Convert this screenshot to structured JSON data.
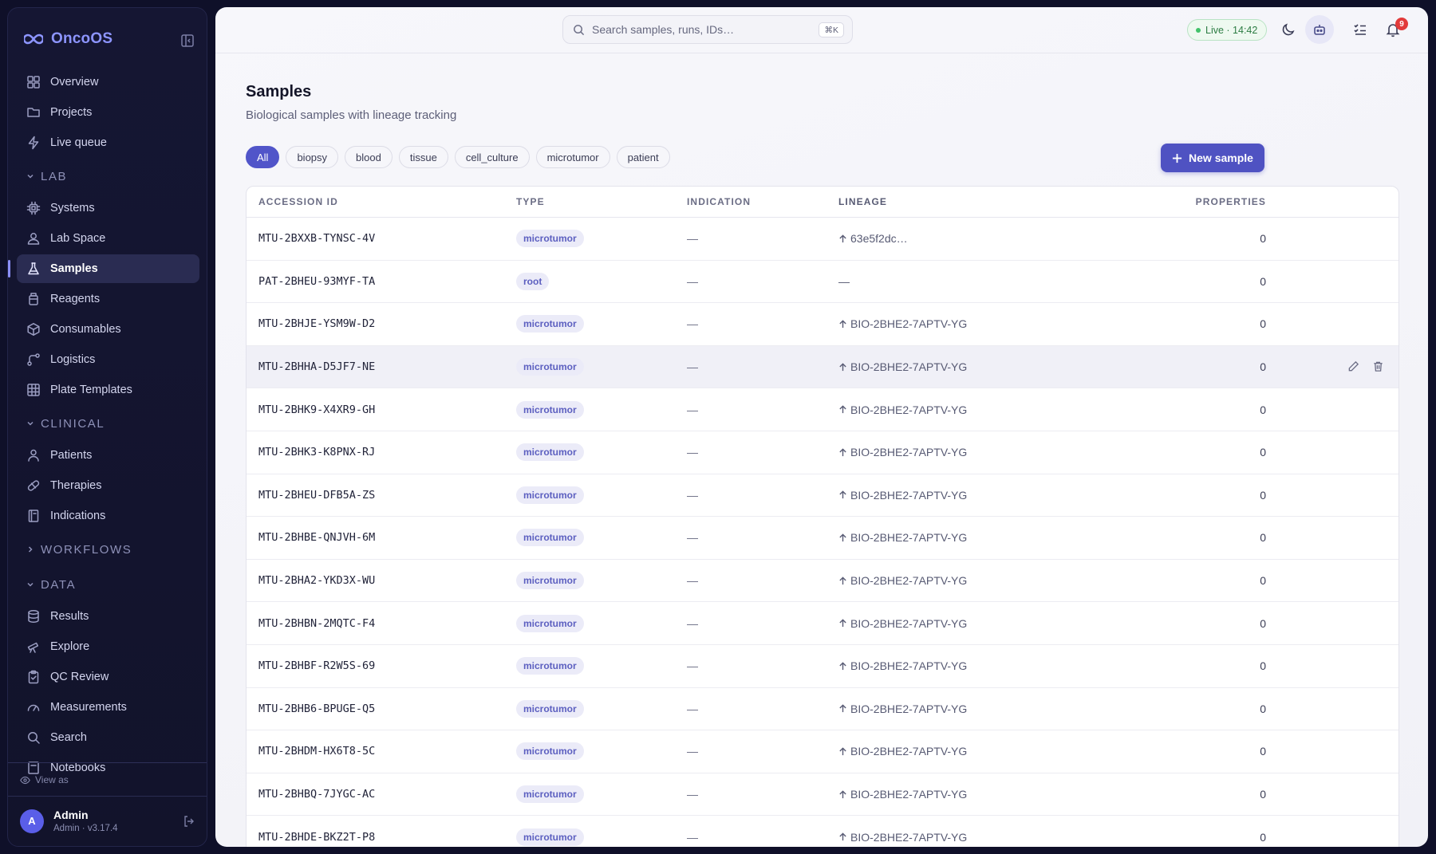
{
  "app": {
    "name": "OncoOS"
  },
  "sidebar": {
    "top_items": [
      {
        "label": "Overview",
        "icon": "grid-icon"
      },
      {
        "label": "Projects",
        "icon": "folder-icon"
      },
      {
        "label": "Live queue",
        "icon": "bolt-icon"
      }
    ],
    "sections": [
      {
        "label": "LAB",
        "expanded": true,
        "items": [
          {
            "label": "Systems",
            "icon": "cpu-icon"
          },
          {
            "label": "Lab Space",
            "icon": "user-space-icon"
          },
          {
            "label": "Samples",
            "icon": "flask-icon",
            "active": true
          },
          {
            "label": "Reagents",
            "icon": "bottle-icon"
          },
          {
            "label": "Consumables",
            "icon": "box-icon"
          },
          {
            "label": "Logistics",
            "icon": "route-icon"
          },
          {
            "label": "Plate Templates",
            "icon": "table-grid-icon"
          }
        ]
      },
      {
        "label": "CLINICAL",
        "expanded": true,
        "items": [
          {
            "label": "Patients",
            "icon": "person-icon"
          },
          {
            "label": "Therapies",
            "icon": "pill-icon"
          },
          {
            "label": "Indications",
            "icon": "book-icon"
          }
        ]
      },
      {
        "label": "WORKFLOWS",
        "expanded": false,
        "items": []
      },
      {
        "label": "DATA",
        "expanded": true,
        "items": [
          {
            "label": "Results",
            "icon": "database-icon"
          },
          {
            "label": "Explore",
            "icon": "telescope-icon"
          },
          {
            "label": "QC Review",
            "icon": "clipboard-icon"
          },
          {
            "label": "Measurements",
            "icon": "gauge-icon"
          },
          {
            "label": "Search",
            "icon": "search-icon"
          },
          {
            "label": "Notebooks",
            "icon": "notebook-icon"
          }
        ]
      }
    ],
    "view_as": "View as",
    "user": {
      "initial": "A",
      "name": "Admin",
      "subtitle": "Admin · v3.17.4"
    }
  },
  "topbar": {
    "search_placeholder": "Search samples, runs, IDs…",
    "search_shortcut": "⌘K",
    "live_label": "Live · 14:42",
    "notifications_count": "9"
  },
  "page": {
    "title": "Samples",
    "subtitle": "Biological samples with lineage tracking",
    "filters": [
      "All",
      "biopsy",
      "blood",
      "tissue",
      "cell_culture",
      "microtumor",
      "patient"
    ],
    "active_filter": "All",
    "new_button": "New sample"
  },
  "table": {
    "columns": {
      "accession": "ACCESSION ID",
      "type": "TYPE",
      "indication": "INDICATION",
      "lineage": "LINEAGE",
      "properties": "PROPERTIES"
    },
    "rows": [
      {
        "accession": "MTU-2BXXB-TYNSC-4V",
        "type": "microtumor",
        "indication": "—",
        "lineage": "63e5f2dc…",
        "lineage_arrow": true,
        "properties": "0"
      },
      {
        "accession": "PAT-2BHEU-93MYF-TA",
        "type": "root",
        "indication": "—",
        "lineage": "—",
        "lineage_arrow": false,
        "properties": "0"
      },
      {
        "accession": "MTU-2BHJE-YSM9W-D2",
        "type": "microtumor",
        "indication": "—",
        "lineage": "BIO-2BHE2-7APTV-YG",
        "lineage_arrow": true,
        "properties": "0"
      },
      {
        "accession": "MTU-2BHHA-D5JF7-NE",
        "type": "microtumor",
        "indication": "—",
        "lineage": "BIO-2BHE2-7APTV-YG",
        "lineage_arrow": true,
        "properties": "0",
        "hover": true
      },
      {
        "accession": "MTU-2BHK9-X4XR9-GH",
        "type": "microtumor",
        "indication": "—",
        "lineage": "BIO-2BHE2-7APTV-YG",
        "lineage_arrow": true,
        "properties": "0"
      },
      {
        "accession": "MTU-2BHK3-K8PNX-RJ",
        "type": "microtumor",
        "indication": "—",
        "lineage": "BIO-2BHE2-7APTV-YG",
        "lineage_arrow": true,
        "properties": "0"
      },
      {
        "accession": "MTU-2BHEU-DFB5A-ZS",
        "type": "microtumor",
        "indication": "—",
        "lineage": "BIO-2BHE2-7APTV-YG",
        "lineage_arrow": true,
        "properties": "0"
      },
      {
        "accession": "MTU-2BHBE-QNJVH-6M",
        "type": "microtumor",
        "indication": "—",
        "lineage": "BIO-2BHE2-7APTV-YG",
        "lineage_arrow": true,
        "properties": "0"
      },
      {
        "accession": "MTU-2BHA2-YKD3X-WU",
        "type": "microtumor",
        "indication": "—",
        "lineage": "BIO-2BHE2-7APTV-YG",
        "lineage_arrow": true,
        "properties": "0"
      },
      {
        "accession": "MTU-2BHBN-2MQTC-F4",
        "type": "microtumor",
        "indication": "—",
        "lineage": "BIO-2BHE2-7APTV-YG",
        "lineage_arrow": true,
        "properties": "0"
      },
      {
        "accession": "MTU-2BHBF-R2W5S-69",
        "type": "microtumor",
        "indication": "—",
        "lineage": "BIO-2BHE2-7APTV-YG",
        "lineage_arrow": true,
        "properties": "0"
      },
      {
        "accession": "MTU-2BHB6-BPUGE-Q5",
        "type": "microtumor",
        "indication": "—",
        "lineage": "BIO-2BHE2-7APTV-YG",
        "lineage_arrow": true,
        "properties": "0"
      },
      {
        "accession": "MTU-2BHDM-HX6T8-5C",
        "type": "microtumor",
        "indication": "—",
        "lineage": "BIO-2BHE2-7APTV-YG",
        "lineage_arrow": true,
        "properties": "0"
      },
      {
        "accession": "MTU-2BHBQ-7JYGC-AC",
        "type": "microtumor",
        "indication": "—",
        "lineage": "BIO-2BHE2-7APTV-YG",
        "lineage_arrow": true,
        "properties": "0"
      },
      {
        "accession": "MTU-2BHDE-BKZ2T-P8",
        "type": "microtumor",
        "indication": "—",
        "lineage": "BIO-2BHE2-7APTV-YG",
        "lineage_arrow": true,
        "properties": "0"
      }
    ]
  }
}
